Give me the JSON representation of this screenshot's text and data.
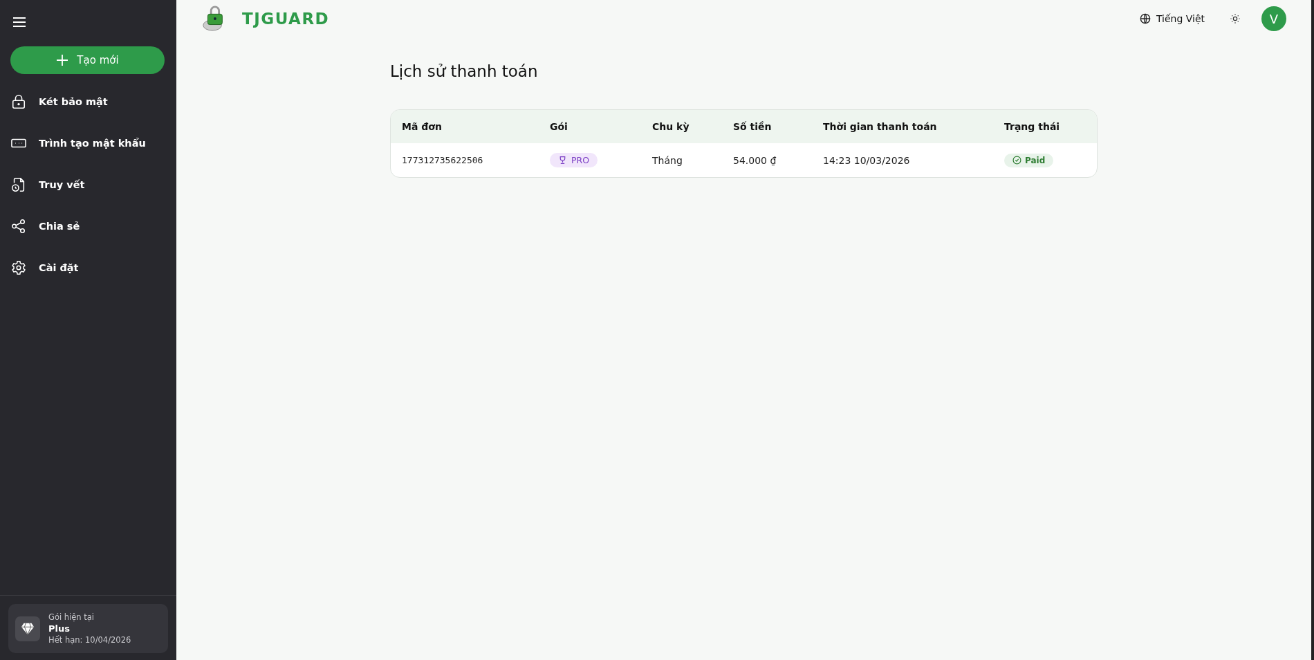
{
  "sidebar": {
    "create_button": "Tạo mới",
    "items": [
      {
        "label": "Két bảo mật",
        "kind": "lock"
      },
      {
        "label": "Trình tạo mật khẩu",
        "kind": "password"
      },
      {
        "label": "Truy vết",
        "kind": "trace"
      },
      {
        "label": "Chia sẻ",
        "kind": "share"
      },
      {
        "label": "Cài đặt",
        "kind": "settings"
      }
    ],
    "plan": {
      "caption": "Gói hiện tại",
      "name": "Plus",
      "expiry": "Hết hạn: 10/04/2026"
    }
  },
  "header": {
    "brand": "TJGUARD",
    "language": "Tiếng Việt",
    "avatar": "V"
  },
  "page_title": "Lịch sử thanh toán",
  "table": {
    "columns": [
      "Mã đơn",
      "Gói",
      "Chu kỳ",
      "Số tiền",
      "Thời gian thanh toán",
      "Trạng thái"
    ],
    "rows": [
      {
        "order_id": "177312735622506",
        "plan": "PRO",
        "cycle": "Tháng",
        "amount": "54.000 ₫",
        "paid_at": "14:23 10/03/2026",
        "status": "Paid"
      }
    ]
  }
}
